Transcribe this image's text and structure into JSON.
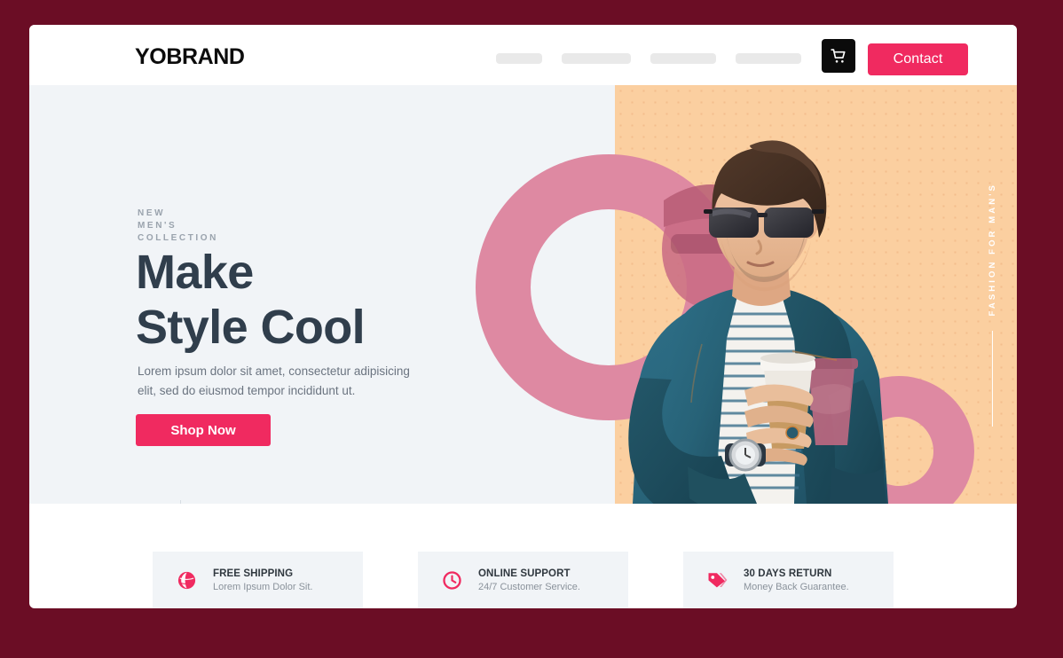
{
  "theme": {
    "page_background": "#6B0D25",
    "accent_pink": "#F02A60",
    "ring_pink": "#DE89A2",
    "hero_left_bg": "#F1F4F7",
    "hero_right_bg": "#FBCFA0",
    "heading_color": "#303E4C"
  },
  "header": {
    "brand": "YOBRAND",
    "nav_placeholder_count": 4,
    "cart_icon": "shopping-cart-icon",
    "contact_label": "Contact"
  },
  "hero": {
    "eyebrow": "NEW\nMEN'S\nCOLLECTION",
    "eyebrow_lines": [
      "NEW",
      "MEN'S",
      "COLLECTION"
    ],
    "title_line1": "Make",
    "title_line2": "Style Cool",
    "description": "Lorem ipsum dolor sit amet, consectetur adipisicing elit, sed do eiusmod tempor incididunt ut.",
    "cta_label": "Shop Now",
    "prev_arrow": "←",
    "next_arrow": "→",
    "side_label": "FASHION FOR MAN'S"
  },
  "features": [
    {
      "icon": "globe-icon",
      "title": "FREE SHIPPING",
      "subtitle": "Lorem Ipsum Dolor Sit."
    },
    {
      "icon": "clock-icon",
      "title": "ONLINE SUPPORT",
      "subtitle": "24/7 Customer Service."
    },
    {
      "icon": "price-tag-icon",
      "title": "30 DAYS RETURN",
      "subtitle": "Money Back Guarantee."
    }
  ]
}
